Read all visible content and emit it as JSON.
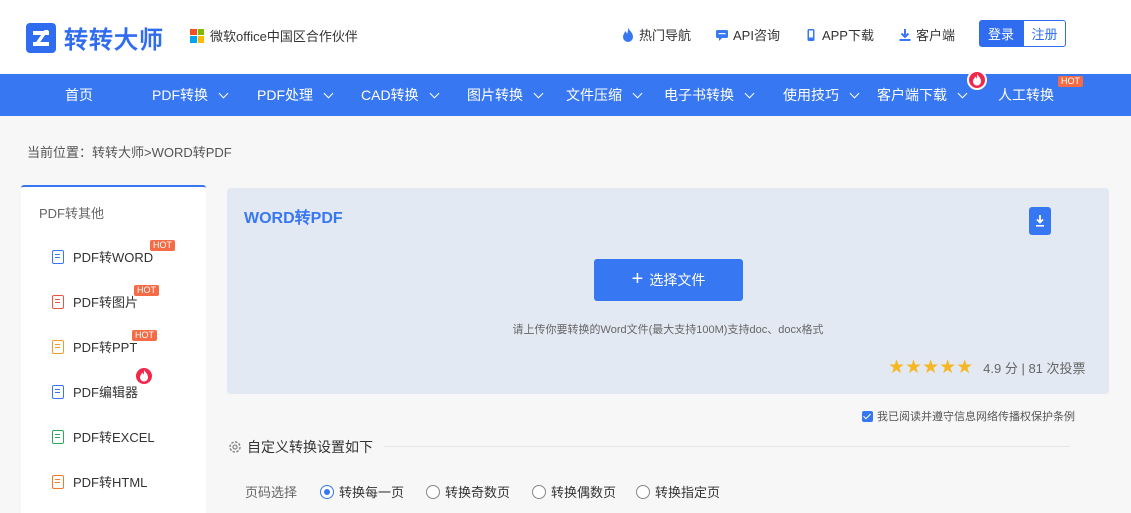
{
  "brand": {
    "name": "转转大师",
    "partner": "微软office中国区合作伙伴"
  },
  "header": {
    "links": [
      {
        "label": "热门导航",
        "icon": "flame-icon"
      },
      {
        "label": "API咨询",
        "icon": "chat-icon"
      },
      {
        "label": "APP下载",
        "icon": "phone-icon"
      },
      {
        "label": "客户端",
        "icon": "download-icon"
      }
    ],
    "login": "登录",
    "register": "注册"
  },
  "nav": {
    "items": [
      "首页",
      "PDF转换",
      "PDF处理",
      "CAD转换",
      "图片转换",
      "文件压缩",
      "电子书转换",
      "使用技巧",
      "客户端下载",
      "人工转换"
    ],
    "hot": "HOT"
  },
  "breadcrumb": "当前位置：转转大师>WORD转PDF",
  "sidebar": {
    "title": "PDF转其他",
    "hot": "HOT",
    "items": [
      {
        "label": "PDF转WORD",
        "color": "#3877f2"
      },
      {
        "label": "PDF转图片",
        "color": "#e8543f"
      },
      {
        "label": "PDF转PPT",
        "color": "#f09a2a"
      },
      {
        "label": "PDF编辑器",
        "color": "#3877f2"
      },
      {
        "label": "PDF转EXCEL",
        "color": "#2aa95a"
      },
      {
        "label": "PDF转HTML",
        "color": "#f07a2a"
      }
    ]
  },
  "panel": {
    "title": "WORD转PDF",
    "select_button": "选择文件",
    "hint": "请上传你要转换的Word文件(最大支持100M)支持doc、docx格式",
    "stars": "★★★★★",
    "rating": "4.9 分 | 81 次投票"
  },
  "agreement": "我已阅读并遵守信息网络传播权保护条例",
  "settings": {
    "title": "自定义转换设置如下",
    "page_label": "页码选择",
    "options": [
      "转换每一页",
      "转换奇数页",
      "转换偶数页",
      "转换指定页"
    ],
    "selected": 0
  },
  "colors": {
    "accent": "#3877f2",
    "hot": "#f56b45",
    "star": "#f5b824"
  }
}
